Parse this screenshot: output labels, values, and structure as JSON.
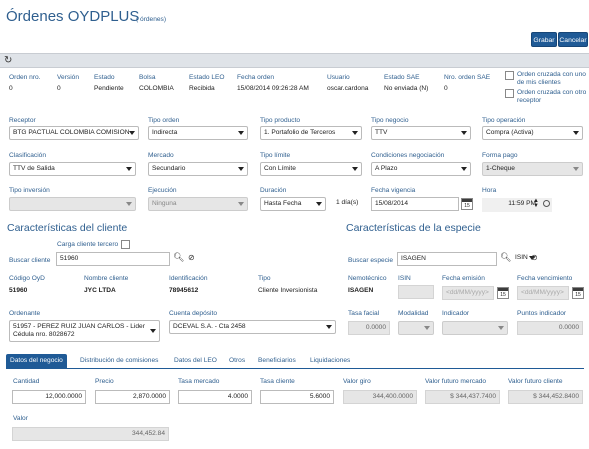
{
  "header": {
    "title": "Órdenes OYDPLUS",
    "subtitle": "( órdenes)",
    "save_label": "Grabar",
    "cancel_label": "Cancelar",
    "refresh_icon": "refresh-icon"
  },
  "summary": {
    "orden_nro_label": "Orden nro.",
    "orden_nro": "0",
    "version_label": "Versión",
    "version": "0",
    "estado_label": "Estado",
    "estado": "Pendiente",
    "bolsa_label": "Bolsa",
    "bolsa": "COLOMBIA",
    "estado_leo_label": "Estado LEO",
    "estado_leo": "Recibida",
    "fecha_orden_label": "Fecha orden",
    "fecha_orden": "15/08/2014 09:26:28 AM",
    "usuario_label": "Usuario",
    "usuario": "oscar.cardona",
    "estado_sae_label": "Estado SAE",
    "estado_sae": "No enviada (N)",
    "nro_orden_sae_label": "Nro. orden SAE",
    "nro_orden_sae": "0",
    "cruzada_mis_clientes": "Orden cruzada con uno de mis clientes",
    "cruzada_otro_receptor": "Orden cruzada con otro receptor"
  },
  "form": {
    "receptor_label": "Receptor",
    "receptor": "BTG PACTUAL COLOMBIA COMISION",
    "tipo_orden_label": "Tipo orden",
    "tipo_orden": "Indirecta",
    "tipo_producto_label": "Tipo producto",
    "tipo_producto": "1. Portafolio de Terceros",
    "tipo_negocio_label": "Tipo negocio",
    "tipo_negocio": "TTV",
    "tipo_operacion_label": "Tipo operación",
    "tipo_operacion": "Compra (Activa)",
    "clasificacion_label": "Clasificación",
    "clasificacion": "TTV de Salida",
    "mercado_label": "Mercado",
    "mercado": "Secundario",
    "tipo_limite_label": "Tipo límite",
    "tipo_limite": "Con Límite",
    "condiciones_label": "Condiciones negociación",
    "condiciones": "A Plazo",
    "forma_pago_label": "Forma pago",
    "forma_pago": "1-Cheque",
    "tipo_inversion_label": "Tipo inversión",
    "tipo_inversion": "",
    "ejecucion_label": "Ejecución",
    "ejecucion": "Ninguna",
    "duracion_label": "Duración",
    "duracion": "Hasta Fecha",
    "dias": "1 día(s)",
    "fecha_vigencia_label": "Fecha vigencia",
    "fecha_vigencia": "15/08/2014",
    "hora_label": "Hora",
    "hora": "11:59 PM",
    "cal_day": "15"
  },
  "cliente": {
    "title": "Características del cliente",
    "carga_tercero_label": "Carga cliente tercero",
    "buscar_label": "Buscar cliente",
    "buscar_value": "51960",
    "codigo_label": "Código OyD",
    "codigo": "51960",
    "nombre_label": "Nombre cliente",
    "nombre": "JYC LTDA",
    "identificacion_label": "Identificación",
    "identificacion": "78945612",
    "tipo_label": "Tipo",
    "tipo": "Cliente Inversionista",
    "ordenante_label": "Ordenante",
    "ordenante_line1": "51957 - PEREZ RUIZ JUAN  CARLOS - Lider",
    "ordenante_line2": "Cédula nro. 8028672",
    "cuenta_label": "Cuenta depósito",
    "cuenta": "DCEVAL S.A. - Cta 2458"
  },
  "especie": {
    "title": "Características de la especie",
    "buscar_label": "Buscar especie",
    "buscar_value": "ISAGEN",
    "isin_select": "ISIN",
    "nemotecnico_label": "Nemotécnico",
    "nemotecnico": "ISAGEN",
    "isin_label": "ISIN",
    "fecha_emision_label": "Fecha emisión",
    "fecha_emision_ph": "<dd/MM/yyyy>",
    "fecha_venc_label": "Fecha vencimiento",
    "fecha_venc_ph": "<dd/MM/yyyy>",
    "tasa_facial_label": "Tasa facial",
    "tasa_facial": "0.0000",
    "modalidad_label": "Modalidad",
    "indicador_label": "Indicador",
    "puntos_label": "Puntos indicador",
    "puntos": "0.0000"
  },
  "tabs": [
    {
      "label": "Datos del negocio"
    },
    {
      "label": "Distribución de comisiones"
    },
    {
      "label": "Datos del LEO"
    },
    {
      "label": "Otros"
    },
    {
      "label": "Beneficiarios"
    },
    {
      "label": "Liquidaciones"
    }
  ],
  "negocio": {
    "cantidad_label": "Cantidad",
    "cantidad": "12,000.0000",
    "precio_label": "Precio",
    "precio": "2,870.0000",
    "tasa_mercado_label": "Tasa mercado",
    "tasa_mercado": "4.0000",
    "tasa_cliente_label": "Tasa cliente",
    "tasa_cliente": "5.6000",
    "valor_giro_label": "Valor giro",
    "valor_giro": "344,400.0000",
    "valor_futuro_mercado_label": "Valor futuro mercado",
    "valor_futuro_mercado": "$ 344,437.7400",
    "valor_futuro_cliente_label": "Valor futuro cliente",
    "valor_futuro_cliente": "$ 344,452.8400",
    "valor_label": "Valor",
    "valor": "344,452.84"
  }
}
